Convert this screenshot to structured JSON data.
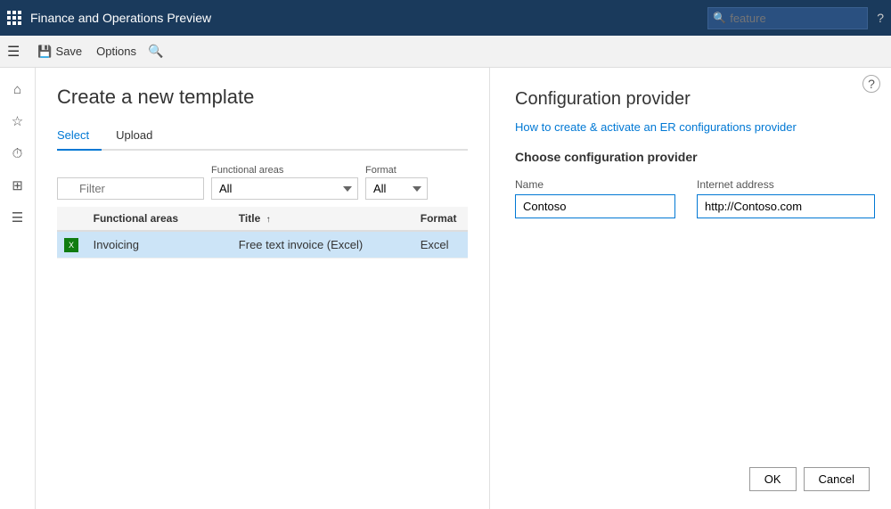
{
  "topbar": {
    "app_title": "Finance and Operations Preview",
    "search_placeholder": "feature",
    "help_label": "?"
  },
  "toolbar": {
    "save_label": "Save",
    "options_label": "Options"
  },
  "sidebar": {
    "icons": [
      {
        "name": "home-icon",
        "symbol": "⌂"
      },
      {
        "name": "favorites-icon",
        "symbol": "☆"
      },
      {
        "name": "recent-icon",
        "symbol": "⏱"
      },
      {
        "name": "modules-icon",
        "symbol": "⊞"
      },
      {
        "name": "list-icon",
        "symbol": "☰"
      }
    ]
  },
  "template_form": {
    "title": "Create a new template",
    "tabs": [
      {
        "id": "select",
        "label": "Select",
        "active": true
      },
      {
        "id": "upload",
        "label": "Upload",
        "active": false
      }
    ],
    "filter": {
      "placeholder": "Filter"
    },
    "functional_areas_label": "Functional areas",
    "functional_areas_value": "All",
    "format_label": "Format",
    "format_value": "All",
    "table": {
      "columns": [
        {
          "id": "icon",
          "label": ""
        },
        {
          "id": "functional_areas",
          "label": "Functional areas"
        },
        {
          "id": "title",
          "label": "Title"
        },
        {
          "id": "format",
          "label": "Format"
        }
      ],
      "rows": [
        {
          "icon": "X",
          "functional_areas": "Invoicing",
          "title": "Free text invoice (Excel)",
          "format": "Excel",
          "selected": true
        }
      ]
    }
  },
  "config_panel": {
    "title": "Configuration provider",
    "link_label": "How to create & activate an ER configurations provider",
    "subtitle": "Choose configuration provider",
    "name_label": "Name",
    "name_value": "Contoso",
    "internet_address_label": "Internet address",
    "internet_address_value": "http://Contoso.com",
    "ok_label": "OK",
    "cancel_label": "Cancel",
    "help_label": "?"
  }
}
